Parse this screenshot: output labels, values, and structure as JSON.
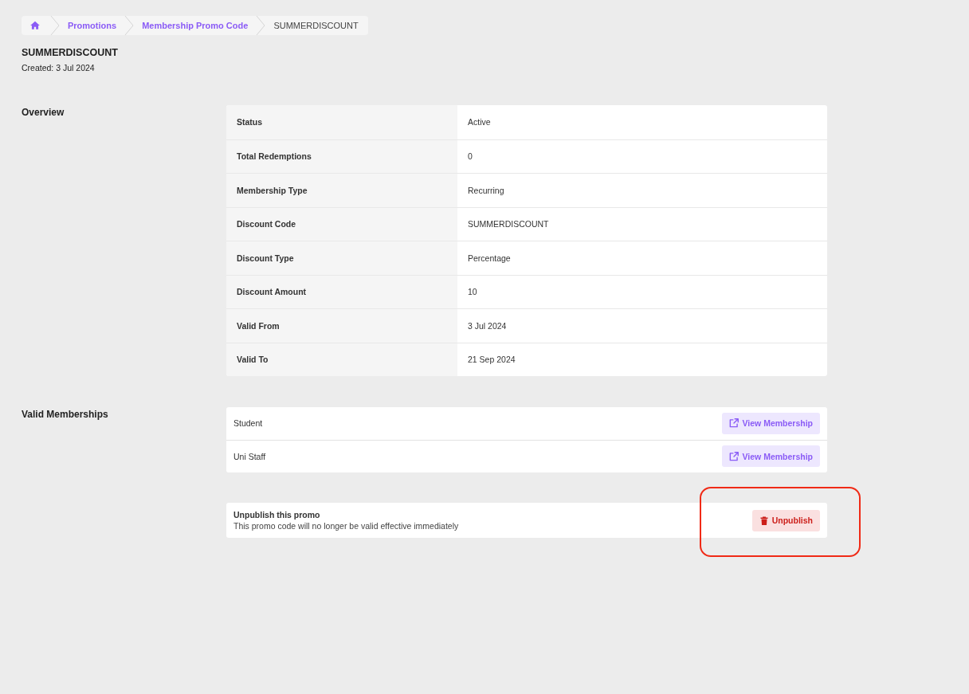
{
  "breadcrumb": [
    {
      "label": "Promotions",
      "kind": "link"
    },
    {
      "label": "Membership Promo Code",
      "kind": "link"
    },
    {
      "label": "SUMMERDISCOUNT",
      "kind": "current"
    }
  ],
  "page": {
    "title": "SUMMERDISCOUNT",
    "created": "Created: 3 Jul 2024"
  },
  "overview": {
    "heading": "Overview",
    "rows": [
      {
        "label": "Status",
        "value": "Active"
      },
      {
        "label": "Total Redemptions",
        "value": "0"
      },
      {
        "label": "Membership Type",
        "value": "Recurring"
      },
      {
        "label": "Discount Code",
        "value": "SUMMERDISCOUNT"
      },
      {
        "label": "Discount Type",
        "value": "Percentage"
      },
      {
        "label": "Discount Amount",
        "value": "10"
      },
      {
        "label": "Valid From",
        "value": "3 Jul 2024"
      },
      {
        "label": "Valid To",
        "value": "21 Sep 2024"
      }
    ]
  },
  "valid_memberships": {
    "heading": "Valid Memberships",
    "items": [
      {
        "name": "Student",
        "action": "View Membership"
      },
      {
        "name": "Uni Staff",
        "action": "View Membership"
      }
    ]
  },
  "unpublish": {
    "title": "Unpublish this promo",
    "description": "This promo code will no longer be valid effective immediately",
    "button": "Unpublish",
    "highlighted": true
  }
}
